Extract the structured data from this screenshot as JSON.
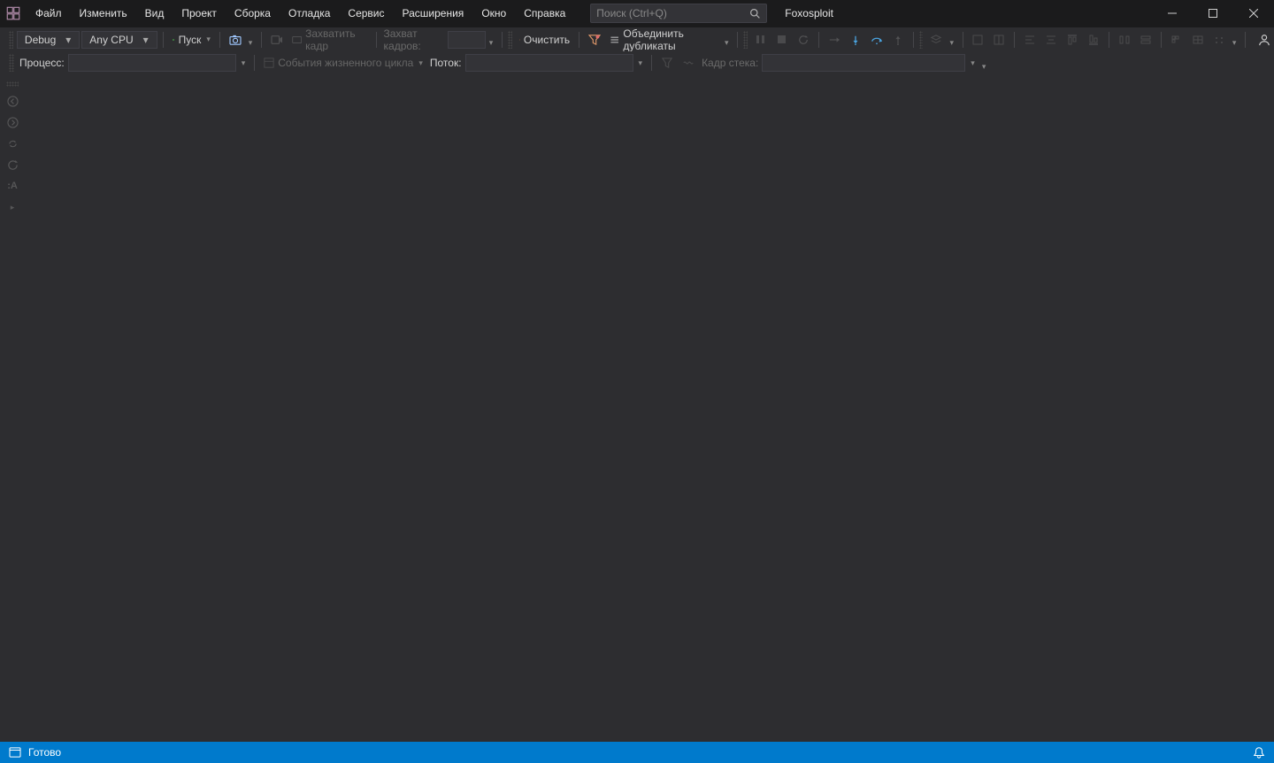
{
  "titlebar": {
    "search_placeholder": "Поиск (Ctrl+Q)",
    "solution_name": "Foxosploit"
  },
  "menu": {
    "items": [
      "Файл",
      "Изменить",
      "Вид",
      "Проект",
      "Сборка",
      "Отладка",
      "Сервис",
      "Расширения",
      "Окно",
      "Справка"
    ]
  },
  "toolbar1": {
    "config": "Debug",
    "platform": "Any CPU",
    "start_label": "Пуск",
    "capture_frame_label": "Захватить кадр",
    "frames_label": "Захват кадров:",
    "frames_value": "",
    "clear_label": "Очистить",
    "merge_label": "Объединить дубликаты"
  },
  "toolbar2": {
    "process_label": "Процесс:",
    "lifecycle_label": "События жизненного цикла",
    "thread_label": "Поток:",
    "stackframe_label": "Кадр стека:"
  },
  "leftstrip": {
    "icons": [
      "nav-back-icon",
      "nav-forward-icon",
      "sync-icon",
      "refresh-icon",
      "text-icon"
    ]
  },
  "statusbar": {
    "ready": "Готово"
  }
}
